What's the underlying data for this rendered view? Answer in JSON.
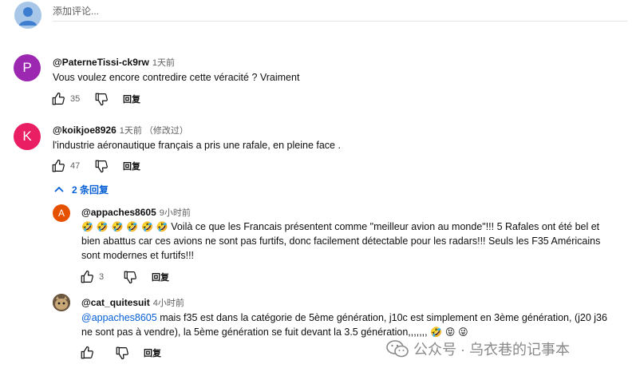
{
  "add_comment": {
    "placeholder": "添加评论..."
  },
  "comments": [
    {
      "avatar_letter": "P",
      "avatar_color": "#9c27b0",
      "author": "@PaterneTissi-ck9rw",
      "time": "1天前",
      "text": "Vous voulez encore contredire cette véracité ? Vraiment",
      "likes": "35",
      "reply_label": "回复"
    },
    {
      "avatar_letter": "K",
      "avatar_color": "#e91e63",
      "author": "@koikjoe8926",
      "time": "1天前 （修改过）",
      "text": "l'industrie aéronautique français a pris une rafale, en pleine face .",
      "likes": "47",
      "reply_label": "回复",
      "replies_toggle": "2 条回复"
    }
  ],
  "replies": [
    {
      "avatar_letter": "A",
      "avatar_color": "#e65100",
      "author": "@appaches8605",
      "time": "9小时前",
      "emojis": "🤣 🤣 🤣 🤣 🤣 🤣",
      "text": " Voilà ce que les Francais présentent comme \"meilleur avion au monde\"!!!  5 Rafales ont été bel et bien abattus car ces avions ne sont pas furtifs, donc facilement détectable pour les radars!!! Seuls les F35 Américains sont modernes et furtifs!!!",
      "likes": "3",
      "reply_label": "回复"
    },
    {
      "avatar_kind": "photo",
      "author": "@cat_quitesuit",
      "time": "4小时前",
      "mention": "@appaches8605",
      "text": "  mais f35 est dans la catégorie de 5ème génération, j10c est simplement en 3ème génération, (j20 j36 ne sont pas à vendre), la 5ème génération se fuit devant la 3.5 génération,,,,,,, ",
      "emojis": "🤣 😝 😜",
      "likes": "",
      "reply_label": "回复"
    }
  ],
  "watermark": {
    "text": "公众号 · 乌衣巷的记事本"
  },
  "colors": {
    "placeholder_avatar": "#a8c7e8",
    "link": "#065fd4"
  }
}
